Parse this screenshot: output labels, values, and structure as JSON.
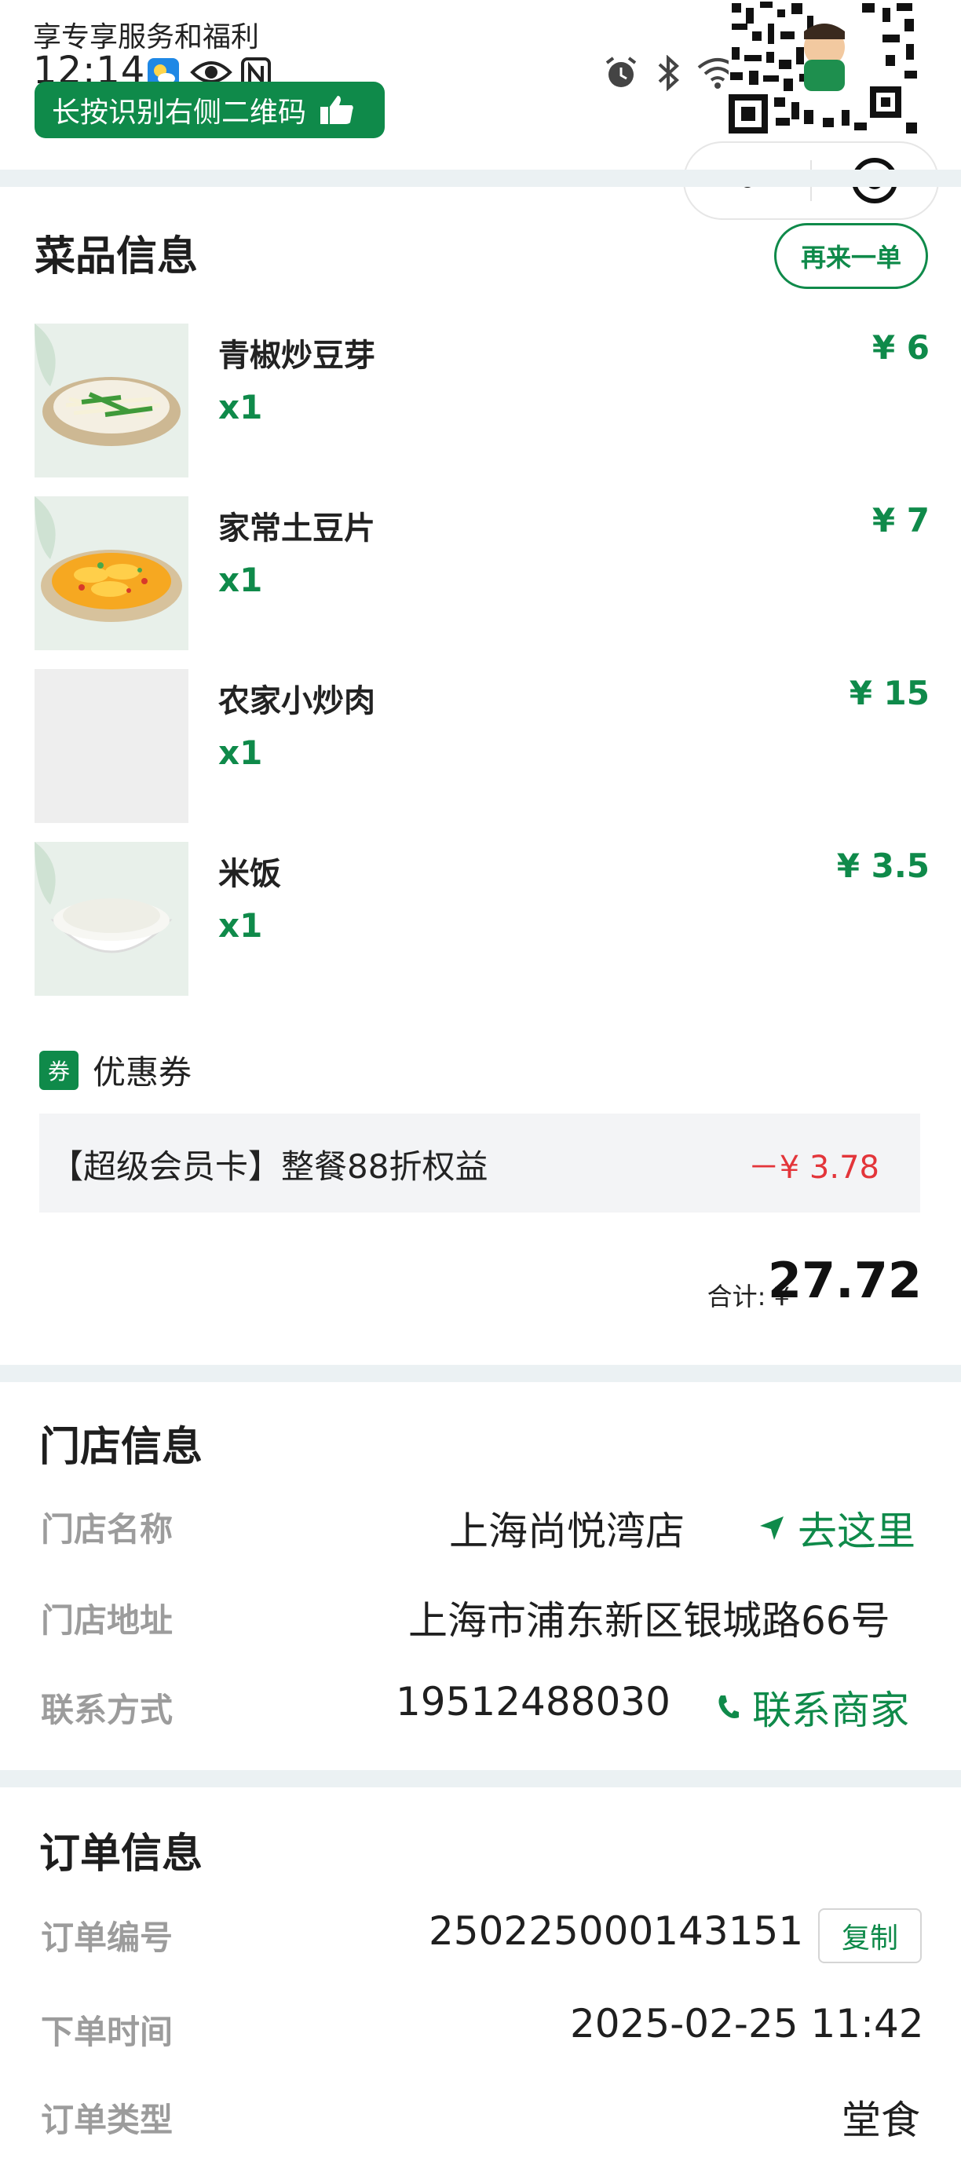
{
  "status_bar": {
    "promo_text": "享专享服务和福利",
    "time": "12:14",
    "promo_button": "长按识别右侧二维码"
  },
  "dishes_section": {
    "title": "菜品信息",
    "reorder_label": "再来一单",
    "items": [
      {
        "name": "青椒炒豆芽",
        "qty": "x1",
        "price": "¥ 6"
      },
      {
        "name": "家常土豆片",
        "qty": "x1",
        "price": "¥ 7"
      },
      {
        "name": "农家小炒肉",
        "qty": "x1",
        "price": "¥ 15"
      },
      {
        "name": "米饭",
        "qty": "x1",
        "price": "¥ 3.5"
      }
    ],
    "coupon_tag": "券",
    "coupon_label": "优惠券",
    "coupon_name": "【超级会员卡】整餐88折权益",
    "coupon_amount": "－¥ 3.78",
    "total_label": "合计: ¥",
    "total_value": "27.72"
  },
  "store_section": {
    "title": "门店信息",
    "name_label": "门店名称",
    "name_value": "上海尚悦湾店",
    "navigate_label": "去这里",
    "address_label": "门店地址",
    "address_value": "上海市浦东新区银城路66号",
    "contact_label": "联系方式",
    "contact_value": "19512488030",
    "contact_action": "联系商家"
  },
  "order_section": {
    "title": "订单信息",
    "number_label": "订单编号",
    "number_value": "250225000143151",
    "copy_label": "复制",
    "time_label": "下单时间",
    "time_value": "2025-02-25 11:42",
    "type_label": "订单类型",
    "type_value": "堂食"
  },
  "colors": {
    "brand_green": "#0f8a4a",
    "discount_red": "#e3353a",
    "section_band": "#ebf1f3"
  }
}
